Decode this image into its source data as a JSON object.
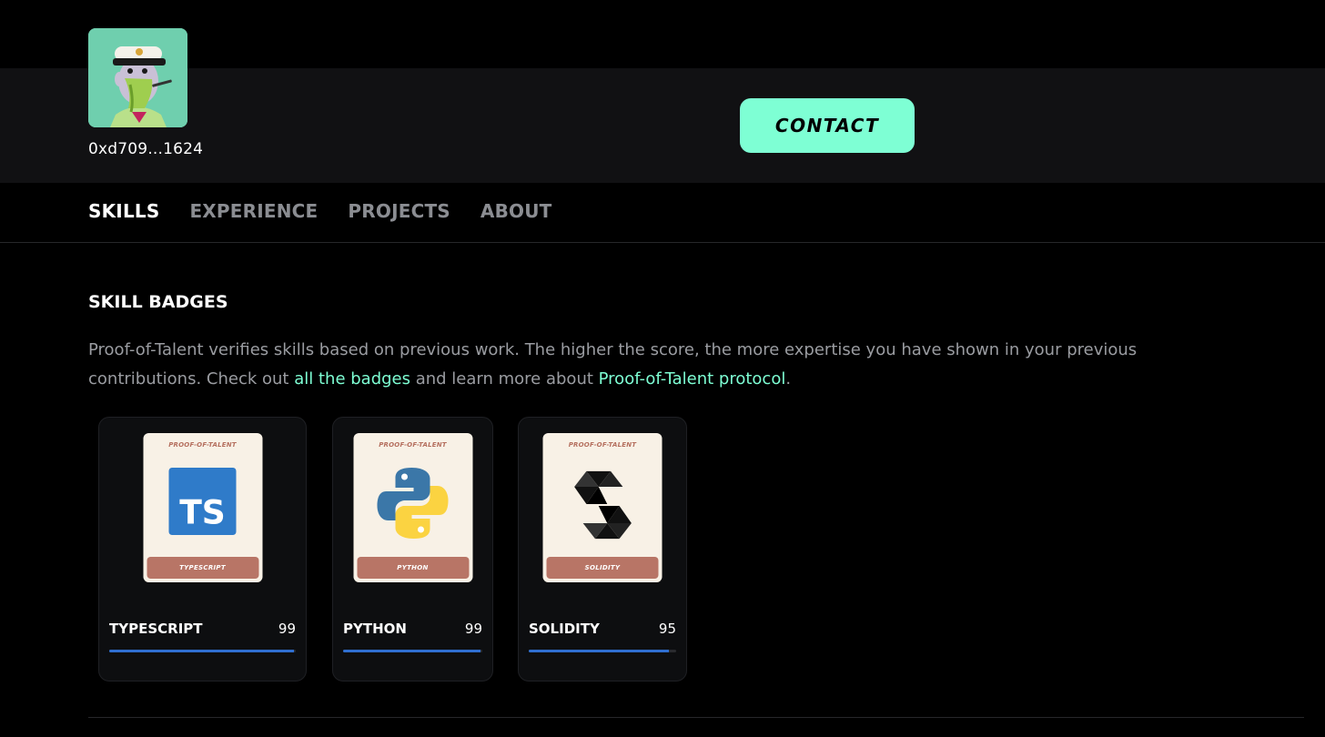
{
  "profile": {
    "wallet": "0xd709...1624"
  },
  "header": {
    "contact_label": "CONTACT"
  },
  "nav": {
    "tabs": [
      {
        "label": "SKILLS",
        "active": true
      },
      {
        "label": "EXPERIENCE",
        "active": false
      },
      {
        "label": "PROJECTS",
        "active": false
      },
      {
        "label": "ABOUT",
        "active": false
      }
    ]
  },
  "skills": {
    "title": "SKILL BADGES",
    "desc_part1": "Proof-of-Talent verifies skills based on previous work. The higher the score, the more expertise you have shown in your previous contributions. Check out ",
    "link_badges": "all the badges",
    "desc_part2": " and learn more about ",
    "link_protocol": "Proof-of-Talent protocol",
    "desc_part3": ".",
    "badge_header": "PROOF-OF-TALENT",
    "badges": [
      {
        "name": "TYPESCRIPT",
        "badge_label": "TYPESCRIPT",
        "score": "99",
        "score_fraction": 0.99,
        "icon": "typescript-icon"
      },
      {
        "name": "PYTHON",
        "badge_label": "PYTHON",
        "score": "99",
        "score_fraction": 0.99,
        "icon": "python-icon"
      },
      {
        "name": "SOLIDITY",
        "badge_label": "SOLIDITY",
        "score": "95",
        "score_fraction": 0.95,
        "icon": "solidity-icon"
      }
    ]
  },
  "colors": {
    "accent": "#7effd4",
    "progress": "#2f6fd0",
    "badge_label_bg": "#b87566"
  }
}
